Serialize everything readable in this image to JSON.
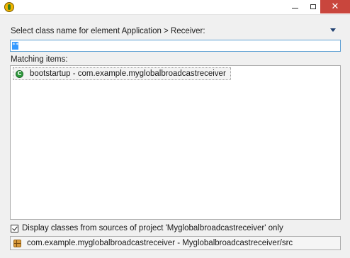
{
  "window": {
    "title": "",
    "app_icon": "eclipse-app-icon",
    "minimize_glyph": "",
    "maximize_glyph": "",
    "close_glyph": "✕"
  },
  "dialog": {
    "header_label": "Select class name for element Application > Receiver:",
    "filter_value": "",
    "matching_label": "Matching items:",
    "items": [
      {
        "label": "bootstartup - com.example.myglobalbroadcastreceiver",
        "icon": "class-icon"
      }
    ],
    "checkbox_label": "Display classes from sources of project 'Myglobalbroadcastreceiver' only",
    "checkbox_checked": true,
    "status_text": "com.example.myglobalbroadcastreceiver - Myglobalbroadcastreceiver/src",
    "status_icon": "package-icon"
  },
  "colors": {
    "close_button": "#c9463d",
    "input_border": "#5ea0d4",
    "selection": "#3399ff"
  }
}
